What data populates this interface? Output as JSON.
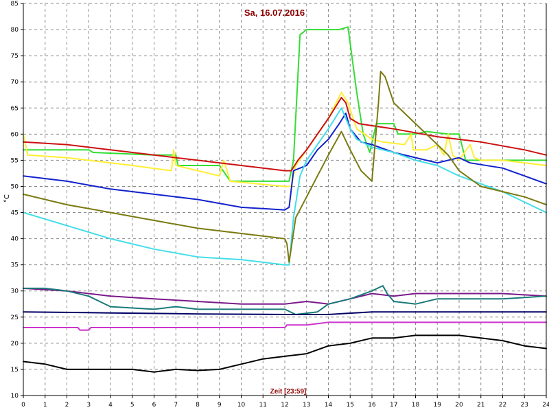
{
  "chart_data": {
    "type": "line",
    "title": "Sa, 16.07.2016",
    "xlabel": "Zeit [23:59]",
    "ylabel": "°C",
    "xlim": [
      0,
      24
    ],
    "ylim": [
      10,
      85
    ],
    "x_ticks": [
      0,
      1,
      2,
      3,
      4,
      5,
      6,
      7,
      8,
      9,
      10,
      11,
      12,
      13,
      14,
      15,
      16,
      17,
      18,
      19,
      20,
      21,
      22,
      23,
      24
    ],
    "y_ticks": [
      10,
      15,
      20,
      25,
      30,
      35,
      40,
      45,
      50,
      55,
      60,
      65,
      70,
      75,
      80,
      85
    ],
    "grid": true,
    "legend": "none",
    "series": [
      {
        "color": "#33dd33",
        "points": [
          [
            0,
            57
          ],
          [
            3,
            57
          ],
          [
            3.2,
            56.5
          ],
          [
            6,
            56
          ],
          [
            7,
            56
          ],
          [
            7.1,
            54
          ],
          [
            9,
            54
          ],
          [
            9.5,
            51
          ],
          [
            12,
            51
          ],
          [
            12.2,
            51
          ],
          [
            12.4,
            55
          ],
          [
            12.7,
            79
          ],
          [
            13,
            80
          ],
          [
            14.5,
            80
          ],
          [
            14.9,
            80.5
          ],
          [
            15.3,
            68
          ],
          [
            15.6,
            60
          ],
          [
            15.9,
            56.5
          ],
          [
            16.2,
            62
          ],
          [
            17,
            62
          ],
          [
            17.2,
            60
          ],
          [
            18,
            60
          ],
          [
            18.5,
            60.5
          ],
          [
            19.5,
            60
          ],
          [
            20,
            60
          ],
          [
            20.3,
            55
          ],
          [
            21,
            55
          ],
          [
            24,
            55
          ]
        ]
      },
      {
        "color": "#ffee33",
        "points": [
          [
            0,
            60
          ],
          [
            0.2,
            56
          ],
          [
            2,
            55.5
          ],
          [
            5,
            54
          ],
          [
            6.8,
            53
          ],
          [
            6.9,
            57
          ],
          [
            7,
            54
          ],
          [
            9,
            52
          ],
          [
            9.2,
            55
          ],
          [
            9.5,
            51
          ],
          [
            12,
            50
          ],
          [
            12.3,
            50
          ],
          [
            12.5,
            54
          ],
          [
            13,
            57
          ],
          [
            13.5,
            60
          ],
          [
            14,
            63
          ],
          [
            14.6,
            68
          ],
          [
            14.9,
            66
          ],
          [
            15.3,
            61
          ],
          [
            16,
            59
          ],
          [
            16.5,
            58.5
          ],
          [
            17.5,
            58
          ],
          [
            17.8,
            60
          ],
          [
            17.9,
            57
          ],
          [
            18.5,
            57
          ],
          [
            19,
            58
          ],
          [
            19.3,
            56
          ],
          [
            19.5,
            60
          ],
          [
            19.7,
            56
          ],
          [
            20,
            55
          ],
          [
            20.5,
            58
          ],
          [
            20.7,
            55.5
          ],
          [
            21,
            55
          ],
          [
            22,
            55
          ],
          [
            24,
            54
          ]
        ]
      },
      {
        "color": "#cc1111",
        "points": [
          [
            0,
            58.5
          ],
          [
            2,
            58
          ],
          [
            4,
            57
          ],
          [
            6,
            56
          ],
          [
            8,
            55
          ],
          [
            10,
            54
          ],
          [
            12,
            53
          ],
          [
            12.3,
            53
          ],
          [
            12.6,
            55
          ],
          [
            13,
            57
          ],
          [
            13.5,
            60
          ],
          [
            14,
            63
          ],
          [
            14.6,
            67
          ],
          [
            14.8,
            66
          ],
          [
            15,
            63
          ],
          [
            15.4,
            62
          ],
          [
            17,
            61
          ],
          [
            19,
            59.5
          ],
          [
            21,
            58.5
          ],
          [
            23,
            57
          ],
          [
            24,
            56
          ]
        ]
      },
      {
        "color": "#1122cc",
        "points": [
          [
            0,
            52
          ],
          [
            2,
            51
          ],
          [
            4,
            49.5
          ],
          [
            6,
            48.5
          ],
          [
            8,
            47.5
          ],
          [
            10,
            46
          ],
          [
            12,
            45.5
          ],
          [
            12.2,
            46
          ],
          [
            12.4,
            53
          ],
          [
            13,
            54
          ],
          [
            13.5,
            57
          ],
          [
            14,
            59
          ],
          [
            14.5,
            62
          ],
          [
            14.8,
            64
          ],
          [
            15,
            61
          ],
          [
            15.5,
            58.5
          ],
          [
            16,
            58
          ],
          [
            17,
            56.5
          ],
          [
            18,
            55.5
          ],
          [
            19,
            54.5
          ],
          [
            20,
            55.5
          ],
          [
            20.5,
            54.5
          ],
          [
            22,
            53.5
          ],
          [
            23,
            52
          ],
          [
            24,
            50.5
          ]
        ]
      },
      {
        "color": "#44dde8",
        "points": [
          [
            0,
            45
          ],
          [
            2,
            42.5
          ],
          [
            4,
            40
          ],
          [
            6,
            38
          ],
          [
            8,
            36.5
          ],
          [
            10,
            36
          ],
          [
            12,
            35
          ],
          [
            12.2,
            35
          ],
          [
            12.4,
            44
          ],
          [
            12.7,
            52
          ],
          [
            13,
            55
          ],
          [
            13.5,
            58
          ],
          [
            14,
            61
          ],
          [
            14.6,
            65
          ],
          [
            15,
            61
          ],
          [
            15.3,
            59
          ],
          [
            16,
            57.5
          ],
          [
            17,
            56.5
          ],
          [
            18,
            55
          ],
          [
            19,
            54
          ],
          [
            20,
            52
          ],
          [
            21,
            50.5
          ],
          [
            22,
            49
          ],
          [
            23,
            47
          ],
          [
            24,
            45
          ]
        ]
      },
      {
        "color": "#7a7a10",
        "points": [
          [
            0,
            48.5
          ],
          [
            2,
            46.5
          ],
          [
            4,
            45
          ],
          [
            6,
            43.5
          ],
          [
            8,
            42
          ],
          [
            10,
            41
          ],
          [
            12,
            40
          ],
          [
            12.1,
            39
          ],
          [
            12.2,
            35.5
          ],
          [
            12.5,
            44
          ],
          [
            13,
            48
          ],
          [
            13.5,
            52
          ],
          [
            14,
            56
          ],
          [
            14.6,
            60.5
          ],
          [
            15,
            57
          ],
          [
            15.5,
            53
          ],
          [
            16,
            51
          ],
          [
            16.3,
            66
          ],
          [
            16.4,
            72
          ],
          [
            16.6,
            71
          ],
          [
            17,
            66
          ],
          [
            17.5,
            64
          ],
          [
            18,
            62
          ],
          [
            18.5,
            60
          ],
          [
            19,
            58
          ],
          [
            19.5,
            56
          ],
          [
            20,
            53
          ],
          [
            21,
            50
          ],
          [
            22,
            49
          ],
          [
            23,
            48
          ],
          [
            24,
            46.5
          ]
        ]
      },
      {
        "color": "#7a1a8a",
        "points": [
          [
            0,
            30.5
          ],
          [
            2,
            30
          ],
          [
            4,
            29
          ],
          [
            6,
            28.5
          ],
          [
            8,
            28
          ],
          [
            10,
            27.5
          ],
          [
            12,
            27.5
          ],
          [
            13,
            28
          ],
          [
            14,
            27.5
          ],
          [
            15,
            28.5
          ],
          [
            16,
            29.5
          ],
          [
            17,
            29
          ],
          [
            18,
            29.5
          ],
          [
            20,
            29.5
          ],
          [
            22,
            29.5
          ],
          [
            24,
            29
          ]
        ]
      },
      {
        "color": "#1a7a7a",
        "points": [
          [
            0,
            30.5
          ],
          [
            1,
            30.5
          ],
          [
            2,
            30
          ],
          [
            3,
            29
          ],
          [
            4,
            27
          ],
          [
            6,
            26.5
          ],
          [
            7,
            27
          ],
          [
            8,
            26.5
          ],
          [
            10,
            26.5
          ],
          [
            12,
            26.5
          ],
          [
            12.5,
            25.5
          ],
          [
            13.5,
            26
          ],
          [
            14,
            27.5
          ],
          [
            15,
            28.5
          ],
          [
            16,
            30
          ],
          [
            16.5,
            31
          ],
          [
            16.7,
            29.5
          ],
          [
            17,
            28
          ],
          [
            18,
            27.5
          ],
          [
            19,
            28.5
          ],
          [
            20,
            28.5
          ],
          [
            22,
            28.5
          ],
          [
            24,
            29
          ]
        ]
      },
      {
        "color": "#000066",
        "points": [
          [
            0,
            26
          ],
          [
            4,
            25.8
          ],
          [
            8,
            25.6
          ],
          [
            12,
            25.5
          ],
          [
            13,
            25.5
          ],
          [
            14,
            25.5
          ],
          [
            16,
            26
          ],
          [
            20,
            26
          ],
          [
            24,
            26
          ]
        ]
      },
      {
        "color": "#cc33cc",
        "points": [
          [
            0,
            23
          ],
          [
            2.5,
            23
          ],
          [
            2.6,
            22.5
          ],
          [
            3,
            22.5
          ],
          [
            3.1,
            23
          ],
          [
            12,
            23
          ],
          [
            12.1,
            23.5
          ],
          [
            13,
            23.5
          ],
          [
            14,
            24
          ],
          [
            24,
            24
          ]
        ]
      },
      {
        "color": "#000000",
        "points": [
          [
            0,
            16.5
          ],
          [
            1,
            16
          ],
          [
            2,
            15
          ],
          [
            3,
            15
          ],
          [
            4,
            15
          ],
          [
            5,
            15
          ],
          [
            6,
            14.5
          ],
          [
            7,
            15
          ],
          [
            8,
            14.8
          ],
          [
            9,
            15
          ],
          [
            10,
            16
          ],
          [
            11,
            17
          ],
          [
            12,
            17.5
          ],
          [
            13,
            18
          ],
          [
            14,
            19.5
          ],
          [
            15,
            20
          ],
          [
            16,
            21
          ],
          [
            17,
            21
          ],
          [
            18,
            21.5
          ],
          [
            19,
            21.5
          ],
          [
            20,
            21.5
          ],
          [
            21,
            21
          ],
          [
            22,
            20.5
          ],
          [
            23,
            19.5
          ],
          [
            24,
            19
          ]
        ]
      }
    ]
  }
}
